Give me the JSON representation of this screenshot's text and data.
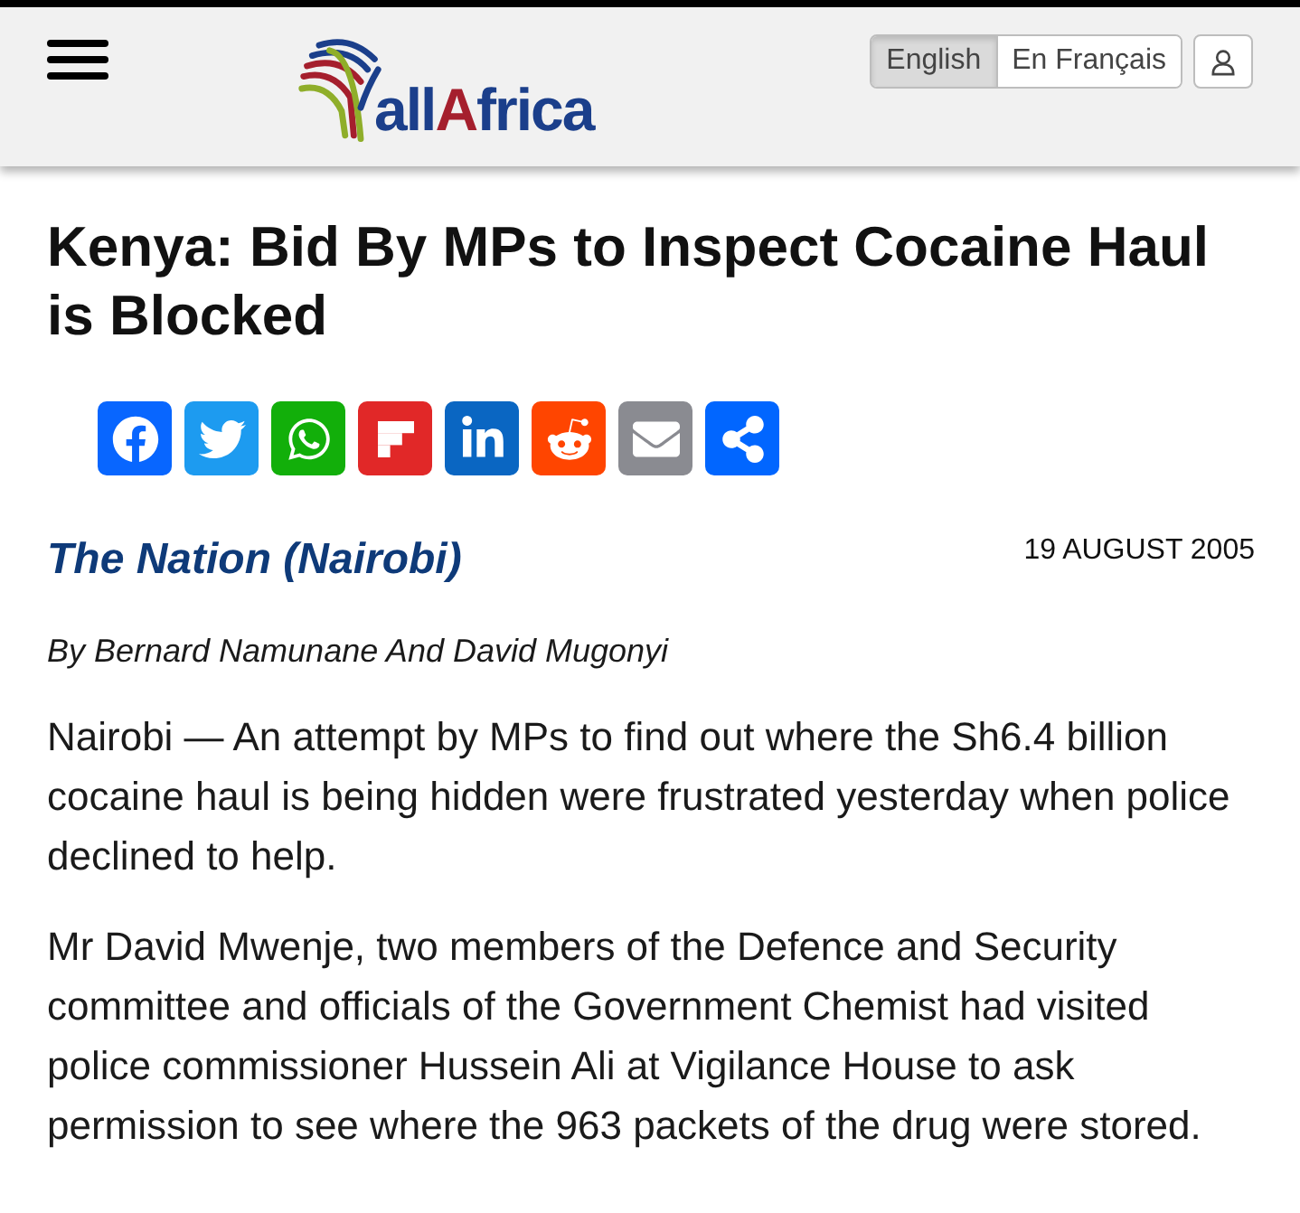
{
  "header": {
    "logo": {
      "parts": [
        {
          "text": "all",
          "accent": false
        },
        {
          "text": "A",
          "accent": true
        },
        {
          "text": "frica",
          "accent": false
        }
      ]
    },
    "languages": [
      {
        "label": "English",
        "selected": true
      },
      {
        "label": "En Français",
        "selected": false
      }
    ]
  },
  "article": {
    "title": "Kenya: Bid By MPs to Inspect Cocaine Haul is Blocked",
    "source": "The Nation (Nairobi)",
    "date": "19 AUGUST 2005",
    "byline": "By Bernard Namunane And David Mugonyi",
    "paragraphs": [
      "Nairobi — An attempt by MPs to find out where the Sh6.4 billion cocaine haul is being hidden were frustrated yesterday when police declined to help.",
      "Mr David Mwenje, two members of the Defence and Security committee and officials of the Government Chemist had visited police commissioner Hussein Ali at Vigilance House to ask permission to see where the 963 packets of the drug were stored."
    ]
  }
}
